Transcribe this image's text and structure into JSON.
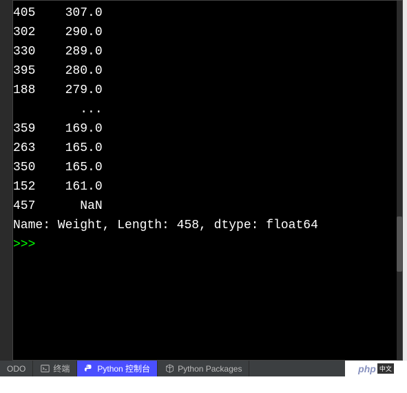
{
  "console": {
    "rows": [
      {
        "index": "405",
        "value": "307.0"
      },
      {
        "index": "302",
        "value": "290.0"
      },
      {
        "index": "330",
        "value": "289.0"
      },
      {
        "index": "395",
        "value": "280.0"
      },
      {
        "index": "188",
        "value": "279.0"
      }
    ],
    "ellipsis": "...",
    "rows2": [
      {
        "index": "359",
        "value": "169.0"
      },
      {
        "index": "263",
        "value": "165.0"
      },
      {
        "index": "350",
        "value": "165.0"
      },
      {
        "index": "152",
        "value": "161.0"
      },
      {
        "index": "457",
        "value": "NaN"
      }
    ],
    "summary": "Name: Weight, Length: 458, dtype: float64",
    "prompt": ">>> "
  },
  "tabs": {
    "todo": "ODO",
    "terminal": "终端",
    "python_console": "Python 控制台",
    "python_packages": "Python Packages"
  },
  "watermark": {
    "php": "php",
    "cn": "中文"
  }
}
